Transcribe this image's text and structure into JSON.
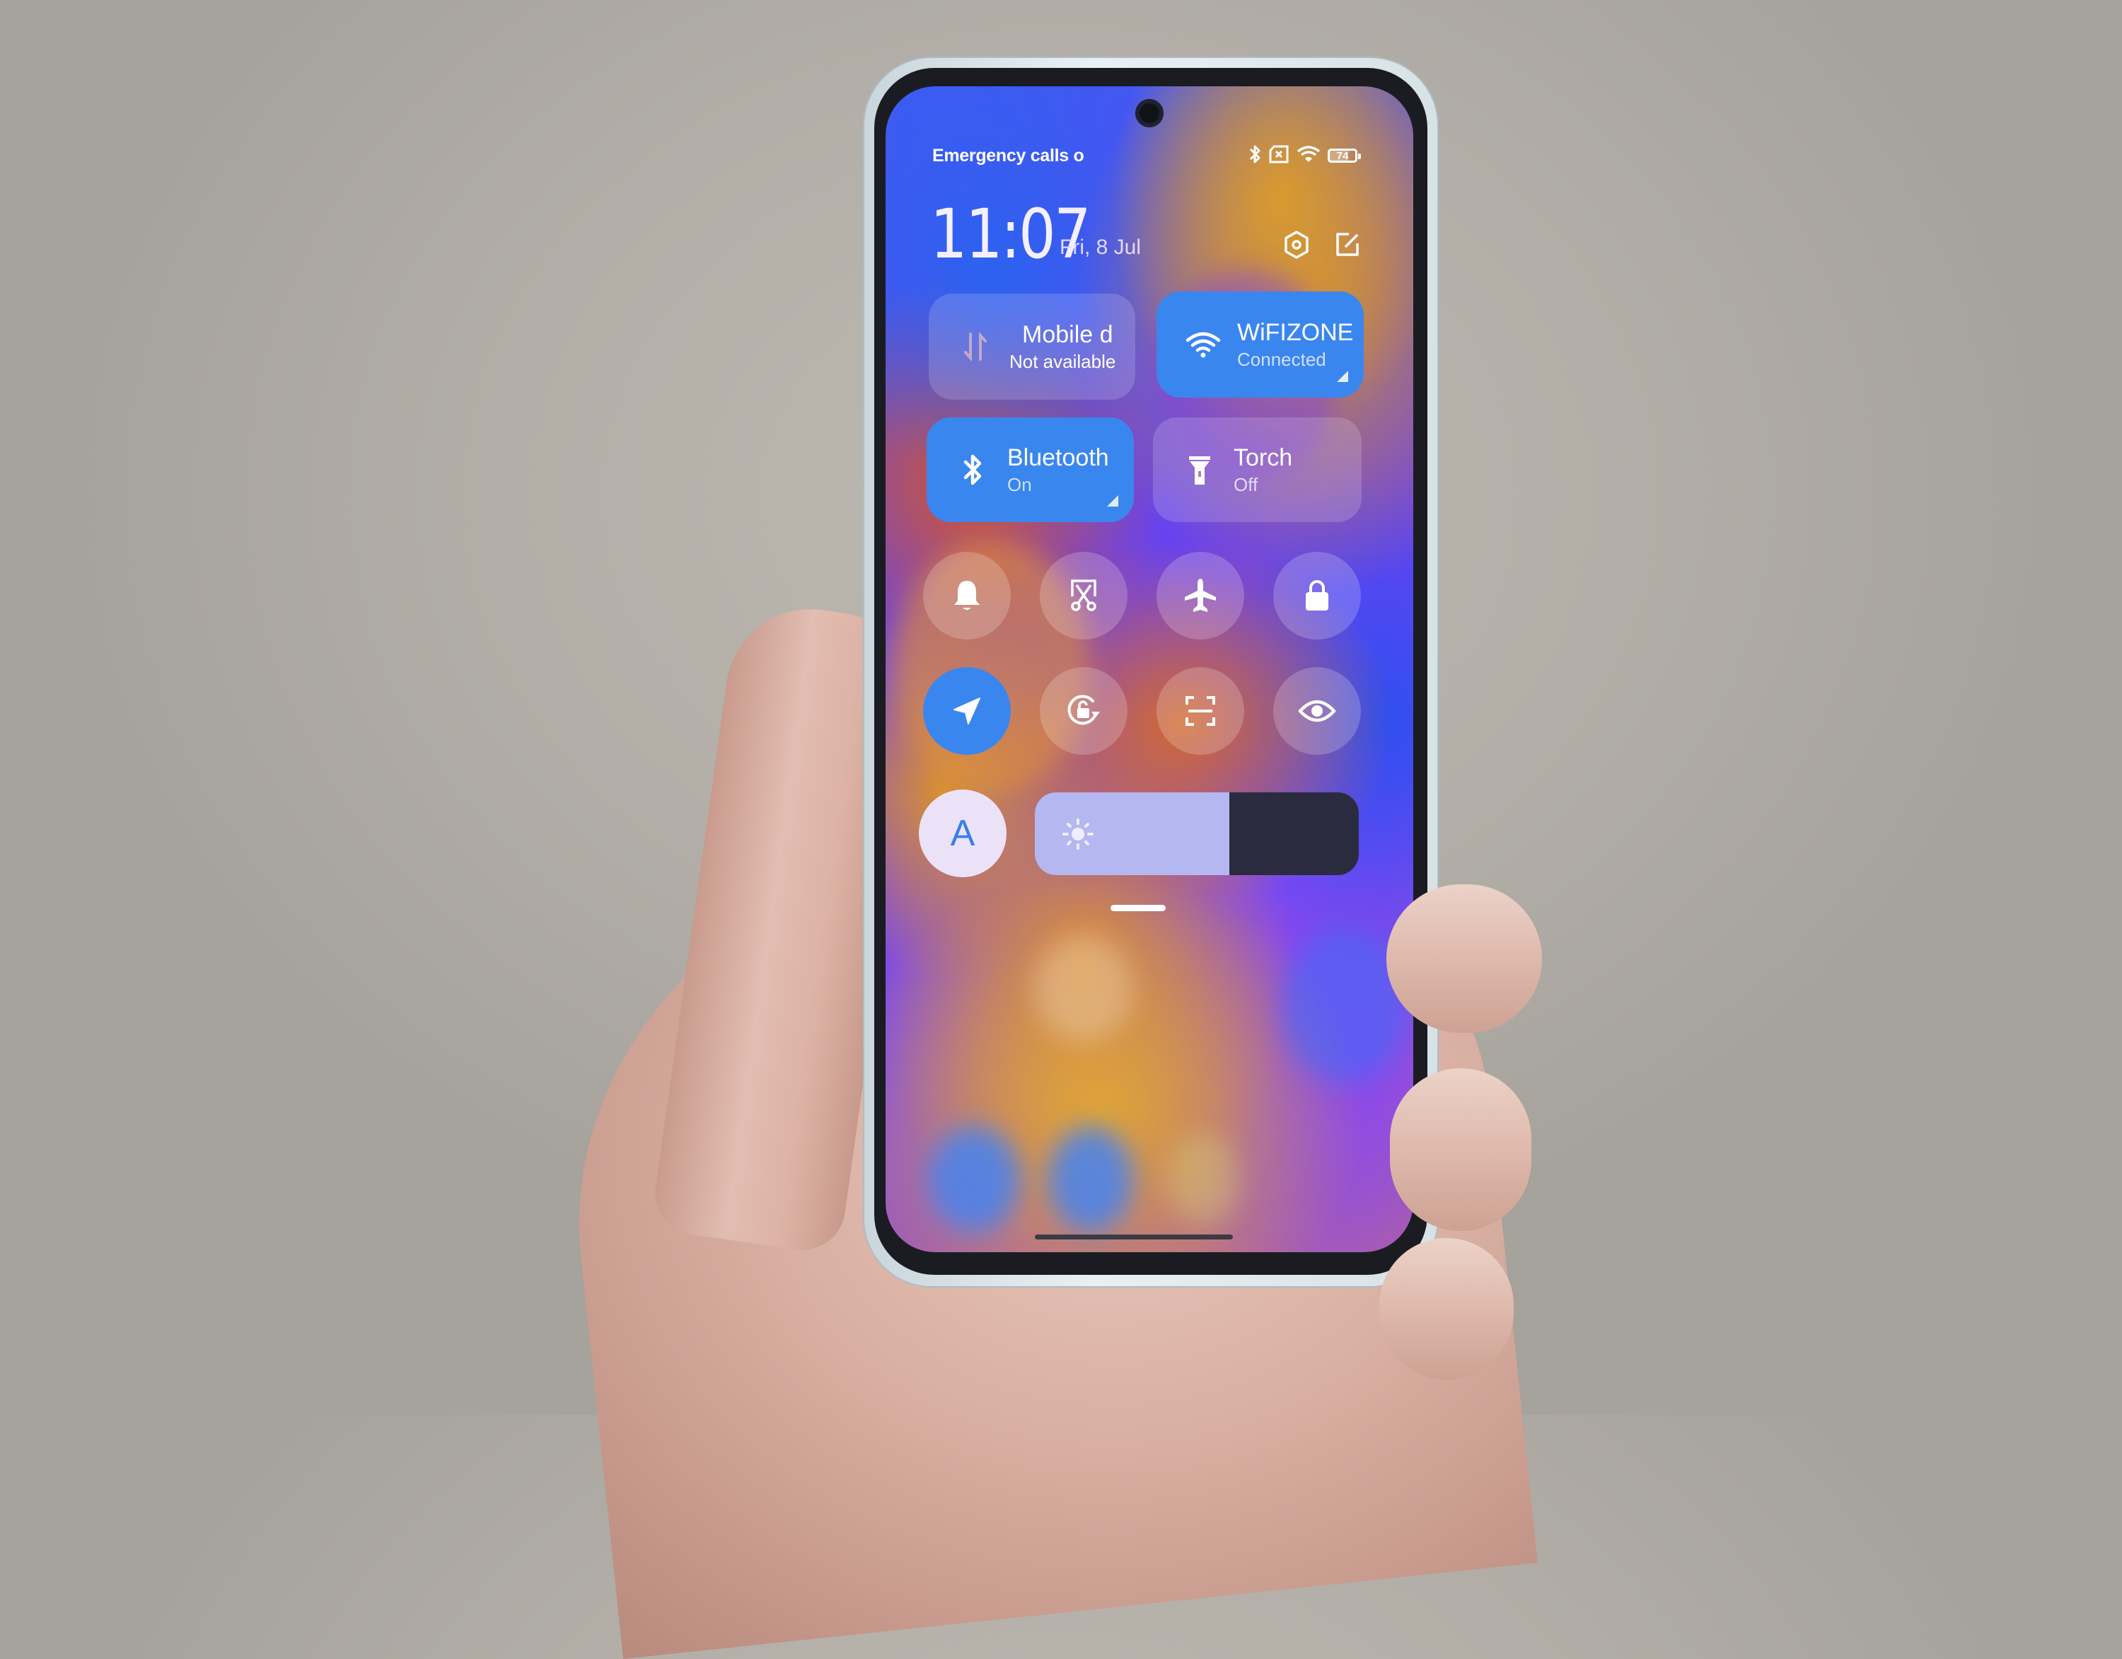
{
  "status_bar": {
    "carrier_text": "Emergency calls o",
    "icons": [
      "bluetooth-icon",
      "no-sim-icon",
      "wifi-icon",
      "battery-icon"
    ],
    "battery_level": "74"
  },
  "header": {
    "time": "11:07",
    "date": "Fri, 8 Jul",
    "actions": [
      "settings-icon",
      "edit-icon"
    ]
  },
  "tiles": [
    {
      "id": "mobile-data",
      "label": "Mobile d",
      "status": "Not available",
      "active": false,
      "icon": "mobile-data-icon"
    },
    {
      "id": "wifi",
      "label": "WiFIZONE",
      "status": "Connected",
      "active": true,
      "icon": "wifi-icon"
    },
    {
      "id": "bluetooth",
      "label": "Bluetooth",
      "status": "On",
      "active": true,
      "icon": "bluetooth-icon"
    },
    {
      "id": "torch",
      "label": "Torch",
      "status": "Off",
      "active": false,
      "icon": "torch-icon"
    }
  ],
  "toggles": [
    {
      "id": "sound",
      "icon": "bell-icon",
      "active": false
    },
    {
      "id": "screenshot",
      "icon": "scissors-icon",
      "active": false
    },
    {
      "id": "airplane",
      "icon": "airplane-icon",
      "active": false
    },
    {
      "id": "lock-screen",
      "icon": "lock-icon",
      "active": false
    },
    {
      "id": "location",
      "icon": "location-arrow-icon",
      "active": true
    },
    {
      "id": "rotation-lock",
      "icon": "rotation-lock-icon",
      "active": false
    },
    {
      "id": "scanner",
      "icon": "scan-icon",
      "active": false
    },
    {
      "id": "reading-mode",
      "icon": "eye-icon",
      "active": false
    }
  ],
  "auto_brightness": {
    "label": "A"
  },
  "brightness": {
    "value_percent": 60
  },
  "colors": {
    "accent": "#3a86ef",
    "slider_fill": "#b5b8f0",
    "slider_track": "#2b2b40"
  }
}
